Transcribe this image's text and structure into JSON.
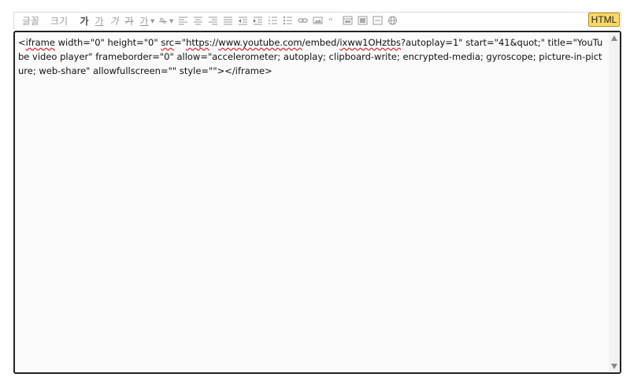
{
  "toolbar": {
    "font_label": "글꼴",
    "size_label": "크기",
    "bold_label": "가",
    "underline_label": "가",
    "italic_label": "가",
    "strike_label": "가",
    "fontcolor_label": "가",
    "html_label": "HTML"
  },
  "editor": {
    "seg1": "<",
    "w_iframe": "iframe",
    "seg2": " width=\"0\" height=\"0\" ",
    "w_src": "src",
    "seg3": "=\"",
    "w_https": "https",
    "seg4": "://",
    "w_domain": "www.youtube.com",
    "seg5": "/embed/",
    "w_id": "ixww1OHztbs",
    "seg6": "?autoplay=1\" start=\"41&quot;\" title=\"YouTube video player\" frameborder=\"0\" allow=\"accelerometer; autoplay; clipboard-write; encrypted-media; gyroscope; picture-in-picture; web-share\" allowfullscreen=\"\" style=\"\"></iframe>"
  },
  "colors": {
    "html_button_bg": "#ffd966",
    "editor_border": "#222222",
    "spell_underline": "#dd2222"
  }
}
